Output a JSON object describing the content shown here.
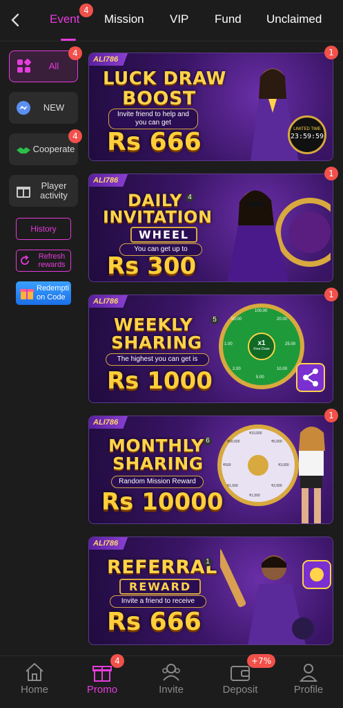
{
  "header": {
    "tabs": [
      {
        "label": "Event",
        "badge": "4",
        "active": true
      },
      {
        "label": "Mission"
      },
      {
        "label": "VIP"
      },
      {
        "label": "Fund"
      },
      {
        "label": "Unclaimed"
      }
    ]
  },
  "sidebar": {
    "items": [
      {
        "label": "All",
        "badge": "4",
        "active": true
      },
      {
        "label": "NEW"
      },
      {
        "label": "Cooperate",
        "badge": "4"
      },
      {
        "label": "Player activity"
      }
    ],
    "history_label": "History",
    "refresh_label": "Refresh rewards",
    "redeem_label": "Redempti on Code"
  },
  "banners": [
    {
      "brand": "ALI786",
      "badge": "1",
      "title_line1": "LUCK DRAW",
      "title_line2": "BOOST",
      "subtitle": "Invite friend to help and you can get",
      "amount": "Rs 666",
      "timer_label": "LIMITED TIME",
      "timer": "23:59:59"
    },
    {
      "brand": "ALI786",
      "badge": "1",
      "title_line1": "DAILY",
      "title_line2": "INVITATION",
      "title_line3": "WHEEL",
      "number": "4",
      "subtitle": "You can get up to",
      "amount": "Rs 300"
    },
    {
      "brand": "ALI786",
      "badge": "1",
      "title_line1": "WEEKLY",
      "title_line2": "SHARING",
      "number": "5",
      "subtitle": "The highest you can get is",
      "amount": "Rs 1000",
      "wheel_center": "x1",
      "wheel_sub": "Free Draw",
      "wheel_values": [
        "100.00",
        "20.00",
        "25.00",
        "10.00",
        "5.00",
        "2.00",
        "1.00",
        "50.00"
      ]
    },
    {
      "brand": "ALI786",
      "badge": "1",
      "title_line1": "MONTHLY",
      "title_line2": "SHARING",
      "number": "6",
      "subtitle": "Random Mission Reward",
      "amount": "Rs 10000",
      "wheel_values": [
        "₹10,000",
        "₹5,000",
        "₹3,000",
        "₹2,000",
        "₹1,500",
        "₹1,000",
        "₹500",
        "₹50,000"
      ]
    },
    {
      "brand": "ALI786",
      "title_line1": "REFERRAL",
      "title_line2": "REWARD",
      "number": "1",
      "subtitle": "Invite a friend to receive",
      "amount": "Rs 666"
    }
  ],
  "bottom_nav": [
    {
      "label": "Home"
    },
    {
      "label": "Promo",
      "badge": "4",
      "active": true
    },
    {
      "label": "Invite"
    },
    {
      "label": "Deposit",
      "badge": "+7%"
    },
    {
      "label": "Profile"
    }
  ],
  "colors": {
    "accent": "#e63cde",
    "badge": "#f2504a",
    "gold": "#ffd34a",
    "purple": "#3a1566"
  }
}
